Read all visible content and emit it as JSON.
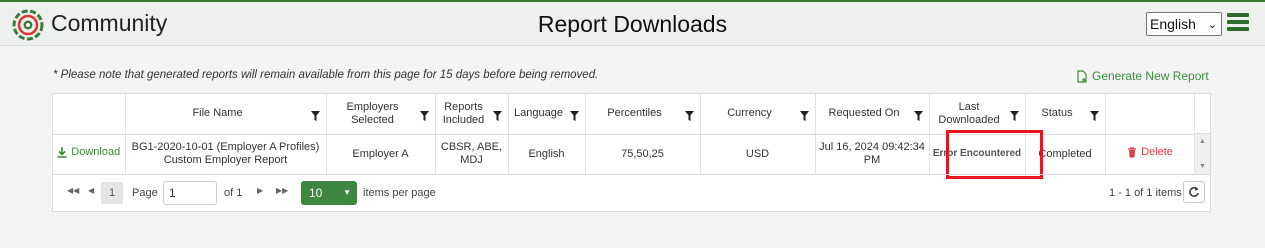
{
  "header": {
    "app_name": "Community",
    "page_title": "Report Downloads",
    "language": "English"
  },
  "note": "* Please note that generated reports will remain available from this page for 15 days before being removed.",
  "actions": {
    "generate_report": "Generate New Report"
  },
  "table": {
    "columns": [
      "",
      "File Name",
      "Employers Selected",
      "Reports Included",
      "Language",
      "Percentiles",
      "Currency",
      "Requested On",
      "Last Downloaded",
      "Status",
      ""
    ],
    "rows": [
      {
        "download_label": "Download",
        "file_name": "BG1-2020-10-01 (Employer A Profiles) Custom Employer Report",
        "employers": "Employer A",
        "reports": "CBSR, ABE, MDJ",
        "language": "English",
        "percentiles": "75,50,25",
        "currency": "USD",
        "requested_on": "Jul 16, 2024 09:42:34 PM",
        "last_downloaded": "Error Encountered",
        "status": "Completed",
        "delete_label": "Delete"
      }
    ]
  },
  "pager": {
    "current_page": "1",
    "page_label": "Page",
    "page_input": "1",
    "of_label": "of 1",
    "page_size": "10",
    "items_per_page_label": "items per page",
    "info": "1 - 1 of 1 items"
  },
  "colors": {
    "brand_green": "#3d8b3d",
    "delete_red": "#e03c3c",
    "highlight_red": "#e8141e"
  }
}
